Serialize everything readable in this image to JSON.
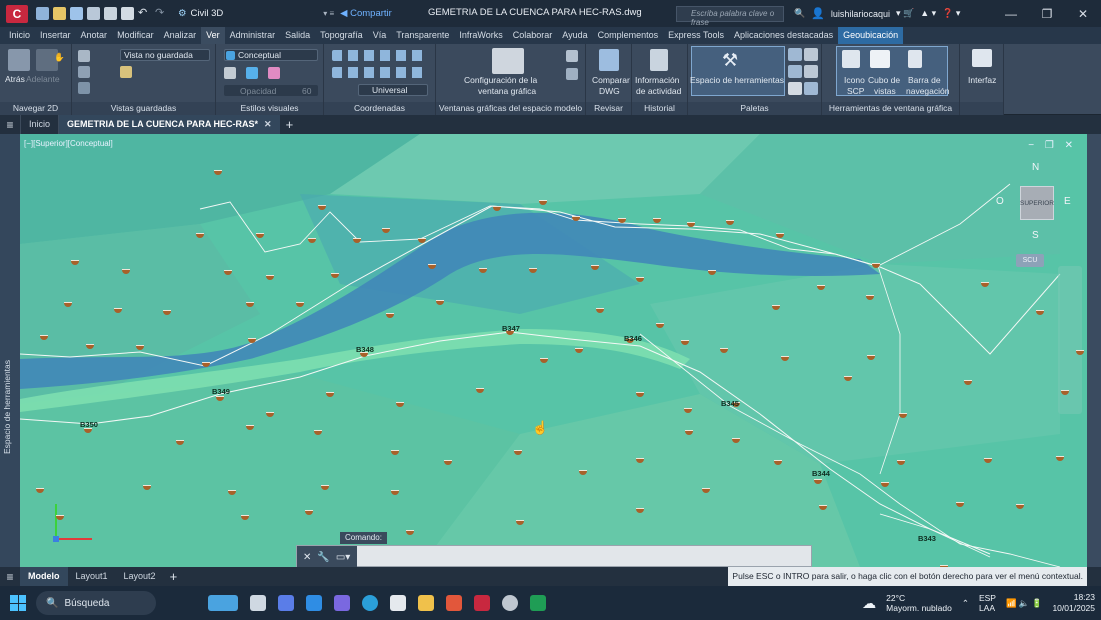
{
  "title_bar": {
    "workspace": "Civil 3D",
    "share": "Compartir",
    "document_title": "GEMETRIA DE LA CUENCA PARA HEC-RAS.dwg",
    "search_placeholder": "Escriba palabra clave o frase",
    "user": "luishilariocaqui"
  },
  "menu": [
    "Inicio",
    "Insertar",
    "Anotar",
    "Modificar",
    "Analizar",
    "Ver",
    "Administrar",
    "Salida",
    "Topografía",
    "Vía",
    "Transparente",
    "InfraWorks",
    "Colaborar",
    "Ayuda",
    "Complementos",
    "Express Tools",
    "Aplicaciones destacadas",
    "Geoubicación"
  ],
  "menu_active": "Ver",
  "ribbon": {
    "nav2d": {
      "atras": "Atrás",
      "adelante": "Adelante",
      "label": "Navegar 2D"
    },
    "vistas": {
      "combo": "Vista no guardada",
      "label": "Vistas guardadas"
    },
    "estilos": {
      "combo": "Conceptual",
      "opacidad": "Opacidad",
      "opacidad_val": "60",
      "label": "Estilos visuales"
    },
    "coordenadas": {
      "combo": "Universal",
      "label": "Coordenadas"
    },
    "ventanas": {
      "config": "Configuración de la",
      "config2": "ventana gráfica",
      "label": "Ventanas gráficas del espacio modelo"
    },
    "revisar": {
      "comparar": "Comparar",
      "dwg": "DWG",
      "label": "Revisar"
    },
    "historial": {
      "info": "Información",
      "info2": "de actividad",
      "label": "Historial"
    },
    "paletas": {
      "espacio": "Espacio de herramientas",
      "label": "Paletas"
    },
    "herr_vent": {
      "icono": "Icono",
      "scp": "SCP",
      "cubo": "Cubo de",
      "vistas": "vistas",
      "barra": "Barra de",
      "navegacion": "navegación",
      "label": "Herramientas de ventana gráfica"
    },
    "interfaz": {
      "label": "Interfaz"
    }
  },
  "doc_tabs": {
    "inicio": "Inicio",
    "active": "GEMETRIA DE LA CUENCA PARA HEC-RAS*"
  },
  "viewport": {
    "label": "[−][Superior][Conceptual]",
    "side_panel": "Espacio de herramientas",
    "viewcube_face": "SUPERIOR",
    "compass": {
      "n": "N",
      "s": "S",
      "e": "E",
      "o": "O"
    },
    "ucs_button": "SCU",
    "command_title": "Comando:",
    "point_labels": [
      "B347",
      "B346",
      "B348",
      "B349",
      "B350",
      "B345",
      "B344",
      "B343"
    ]
  },
  "layout_tabs": [
    "Modelo",
    "Layout1",
    "Layout2"
  ],
  "status_message": "Pulse ESC o INTRO para salir, o haga clic con el botón derecho para ver el menú contextual.",
  "taskbar": {
    "search": "Búsqueda",
    "temp": "22°C",
    "weather": "Mayorm. nublado",
    "lang1": "ESP",
    "lang2": "LAA",
    "time": "18:23",
    "date": "10/01/2025"
  },
  "colors": {
    "terrain": "#57c4a7",
    "river": "#3f85b8",
    "accent": "#2d6ba3"
  }
}
